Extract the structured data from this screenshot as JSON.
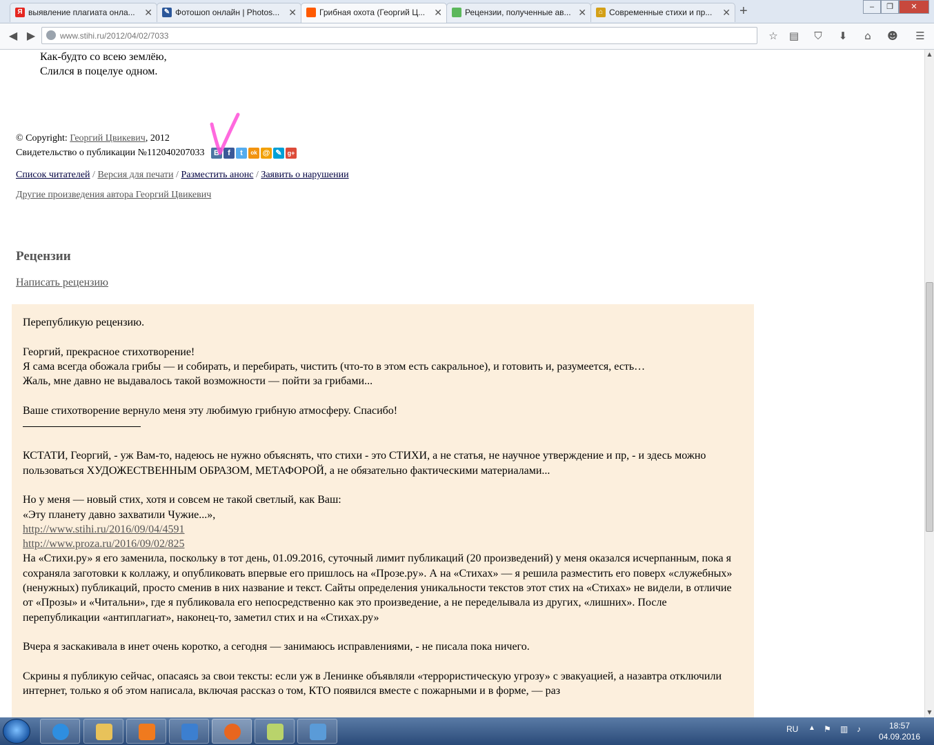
{
  "browser": {
    "tabs": [
      {
        "label": "выявление плагиата онла...",
        "favicon": "yandex-favicon",
        "color": "#e52620",
        "active": false
      },
      {
        "label": "Фотошоп онлайн | Photos...",
        "favicon": "photoshop-favicon",
        "color": "#2b579a",
        "active": false
      },
      {
        "label": "Грибная охота (Георгий Ц...",
        "favicon": "stihi-favicon",
        "color": "#ff5a00",
        "active": true
      },
      {
        "label": "Рецензии, полученные ав...",
        "favicon": "green-favicon",
        "color": "#5cb85c",
        "active": false
      },
      {
        "label": "Современные стихи и пр...",
        "favicon": "home-favicon",
        "color": "#d4a017",
        "active": false
      }
    ],
    "new_tab_symbol": "+",
    "window_buttons": {
      "minimize": "–",
      "maximize": "❐",
      "close": "✕"
    },
    "url": "www.stihi.ru/2012/04/02/7033",
    "toolbar_icons": [
      "star-icon",
      "reading-list-icon",
      "pocket-icon",
      "download-icon",
      "home-icon",
      "chat-icon",
      "menu-icon"
    ]
  },
  "page": {
    "poem_lines": [
      "Как-будто со всею землёю,",
      "Слился в поцелуе одном."
    ],
    "copyright": {
      "prefix": "© Copyright: ",
      "author": "Георгий Цвикевич",
      "year": ", 2012",
      "certificate": "Свидетельство о публикации №112040207033"
    },
    "social_icons": [
      {
        "name": "vkontakte-icon",
        "glyph": "В",
        "color": "#4c75a3"
      },
      {
        "name": "facebook-icon",
        "glyph": "f",
        "color": "#3b5998"
      },
      {
        "name": "twitter-icon",
        "glyph": "t",
        "color": "#55acee"
      },
      {
        "name": "odnoklassniki-icon",
        "glyph": "ok",
        "color": "#f2930f"
      },
      {
        "name": "mailru-icon",
        "glyph": "@",
        "color": "#f2a000"
      },
      {
        "name": "livejournal-icon",
        "glyph": "✎",
        "color": "#00a0d6"
      },
      {
        "name": "googleplus-icon",
        "glyph": "g+",
        "color": "#dd4b39"
      }
    ],
    "links": {
      "readers": "Список читателей",
      "print": "Версия для печати",
      "announce": "Разместить анонс",
      "report": "Заявить о нарушении",
      "separator": " / "
    },
    "other_works": "Другие произведения автора Георгий Цвикевич",
    "reviews_heading": "Рецензии",
    "write_review": "Написать рецензию",
    "review": {
      "p1": "Перепубликую рецензию.",
      "p2": "Георгий, прекрасное стихотворение!",
      "p3": "Я сама всегда обожала грибы — и собирать, и перебирать, чистить (что-то в этом есть сакральное), и готовить и, разумеется, есть…",
      "p4": "Жаль, мне давно не выдавалось такой возможности — пойти за грибами...",
      "p5": "Ваше стихотворение вернуло меня эту любимую грибную атмосферу. Спасибо!",
      "p6": "КСТАТИ, Георгий, - уж Вам-то, надеюсь не нужно объяснять, что стихи - это СТИХИ, а не статья, не научное утверждение и пр, - и здесь можно пользоваться ХУДОЖЕСТВЕННЫМ ОБРАЗОМ, МЕТАФОРОЙ, а не обязательно фактическими материалами...",
      "p7": "Но у меня — новый стих, хотя и совсем не такой светлый, как Ваш:",
      "p8": "«Эту планету давно захватили Чужие...»,",
      "link1": "http://www.stihi.ru/2016/09/04/4591",
      "link2": "http://www.proza.ru/2016/09/02/825",
      "p9": "На «Стихи.ру» я его заменила, поскольку в тот день, 01.09.2016, суточный лимит публикаций (20 произведений) у меня оказался исчерпанным, пока я сохраняла заготовки к коллажу, и опубликовать впервые его пришлось на «Прозе.ру». А на «Стихах» — я решила разместить его поверх «служебных» (ненужных) публикаций, просто сменив в них название и текст. Сайты определения уникальности текстов этот стих на «Стихах» не видели, в отличие от «Прозы» и «Читальни», где я публиковала его непосредственно как это произведение, а не переделывала из других, «лишних». После перепубликации «антиплагиат», наконец-то, заметил стих и на «Стихах.ру»",
      "p10": "Вчера я заскакивала в инет очень коротко, а сегодня — занимаюсь исправлениями, - не писала пока ничего.",
      "p11": "Скрины я публикую сейчас, опасаясь за свои тексты: если уж в Ленинке объявляли «террористическую угрозу» с эвакуацией, а назавтра отключили интернет, только я об этом написала, включая рассказ о том, КТО появился вместе с пожарными и в форме, — раз"
    }
  },
  "taskbar": {
    "apps": [
      {
        "name": "internet-explorer-icon",
        "color": "#2e8ee0"
      },
      {
        "name": "explorer-folder-icon",
        "color": "#e8c25a"
      },
      {
        "name": "media-player-icon",
        "color": "#f07a1e"
      },
      {
        "name": "wordpad-icon",
        "color": "#3c7fd0"
      },
      {
        "name": "firefox-icon",
        "color": "#e8661f"
      },
      {
        "name": "paint-icon",
        "color": "#b9d36b"
      },
      {
        "name": "photo-viewer-icon",
        "color": "#5a9bd8"
      }
    ],
    "lang": "RU",
    "time": "18:57",
    "date": "04.09.2016"
  }
}
